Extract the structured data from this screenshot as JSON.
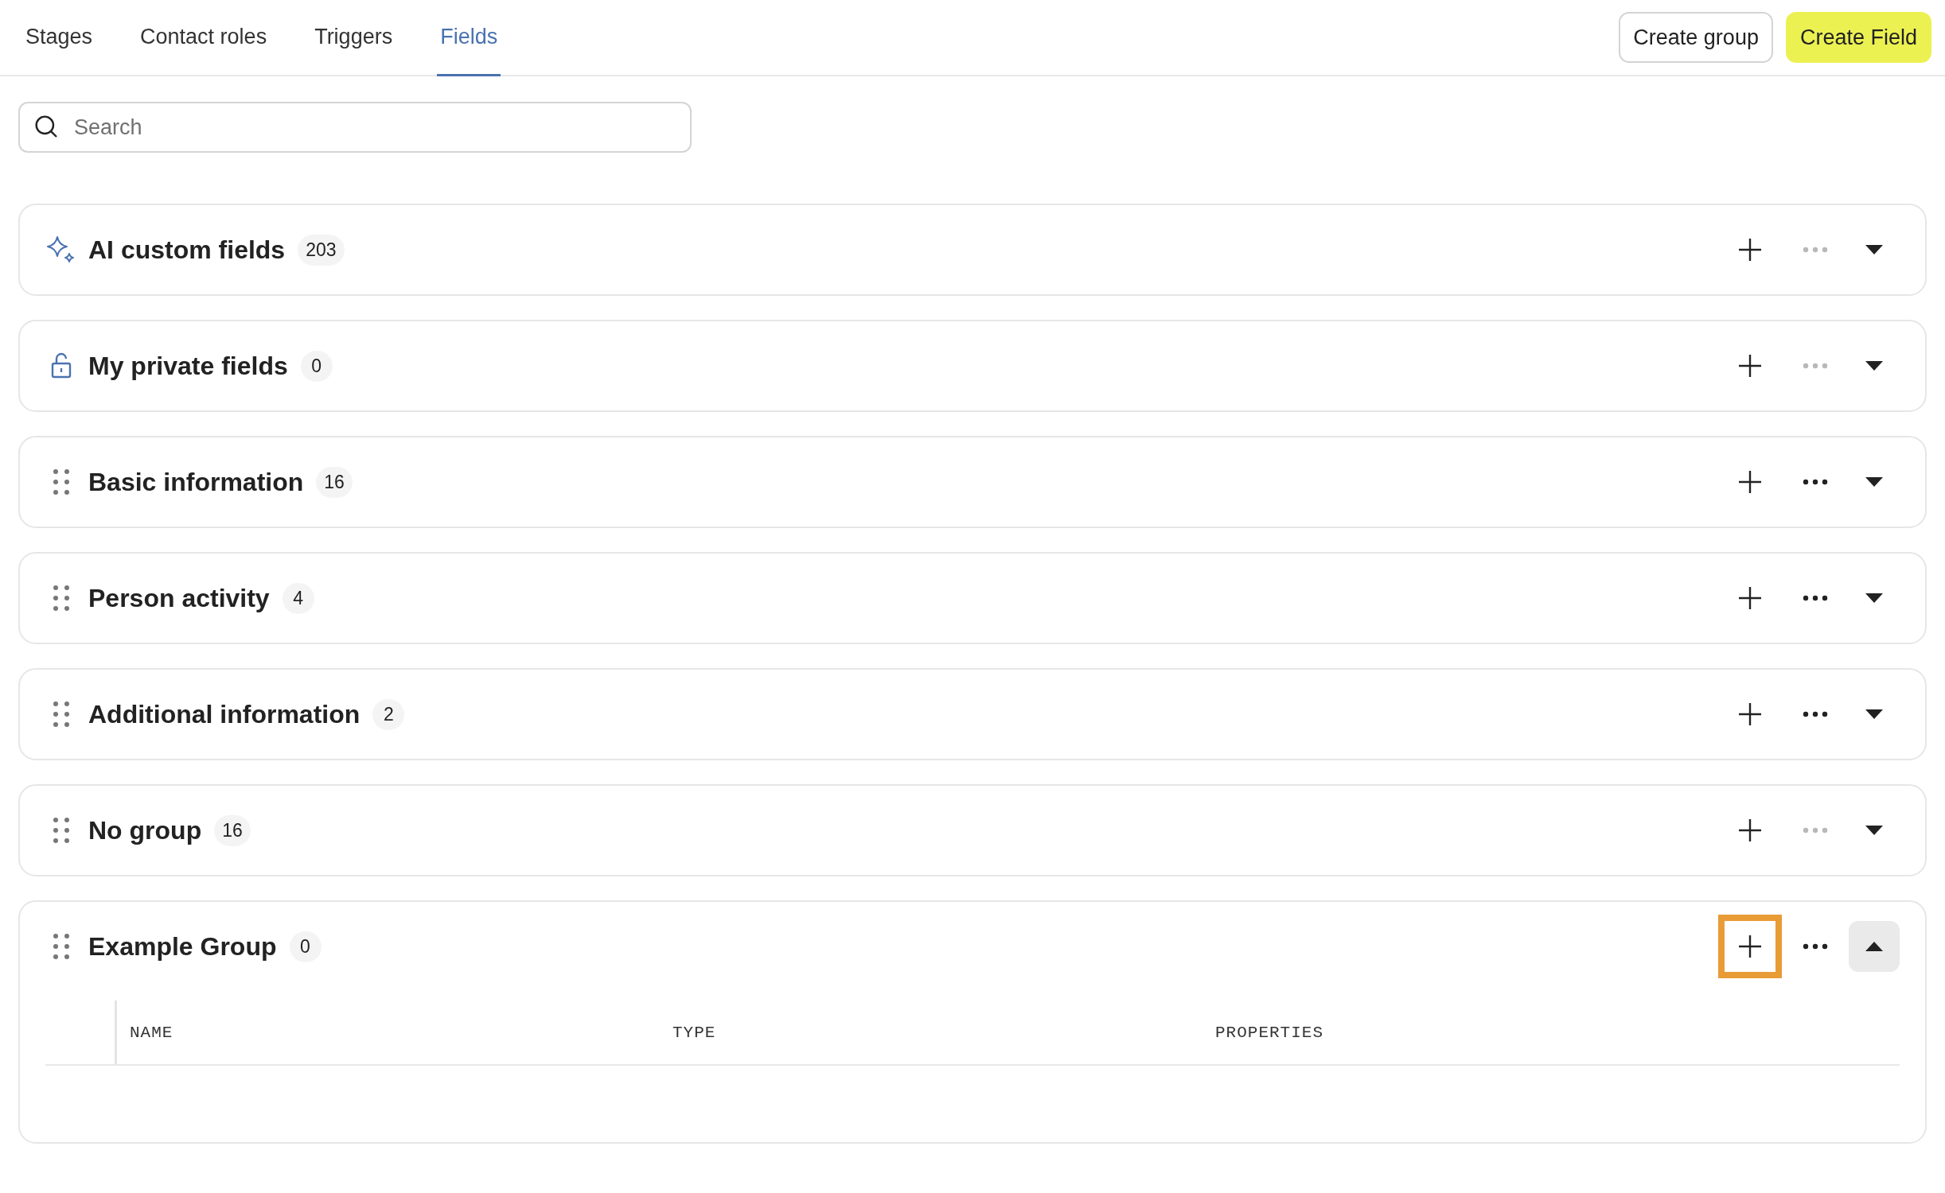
{
  "tabs": [
    {
      "label": "Stages",
      "selected": false
    },
    {
      "label": "Contact roles",
      "selected": false
    },
    {
      "label": "Triggers",
      "selected": false
    },
    {
      "label": "Fields",
      "selected": true
    }
  ],
  "actions": [
    {
      "label": "Create group",
      "kind": "secondary"
    },
    {
      "label": "Create Field",
      "kind": "primary"
    }
  ],
  "search": {
    "placeholder": "Search"
  },
  "groups": [
    {
      "kind": "ai",
      "title": "AI custom fields",
      "count": "203",
      "more_disabled": true,
      "expanded": false,
      "add_highlighted": false
    },
    {
      "kind": "private",
      "title": "My private fields",
      "count": "0",
      "more_disabled": true,
      "expanded": false,
      "add_highlighted": false
    },
    {
      "kind": "drag",
      "title": "Basic information",
      "count": "16",
      "more_disabled": false,
      "expanded": false,
      "add_highlighted": false
    },
    {
      "kind": "drag",
      "title": "Person activity",
      "count": "4",
      "more_disabled": false,
      "expanded": false,
      "add_highlighted": false
    },
    {
      "kind": "drag",
      "title": "Additional information",
      "count": "2",
      "more_disabled": false,
      "expanded": false,
      "add_highlighted": false
    },
    {
      "kind": "drag",
      "title": "No group",
      "count": "16",
      "more_disabled": true,
      "expanded": false,
      "add_highlighted": false
    },
    {
      "kind": "drag",
      "title": "Example Group",
      "count": "0",
      "more_disabled": false,
      "expanded": true,
      "add_highlighted": true,
      "columns": [
        "NAME",
        "TYPE",
        "PROPERTIES"
      ]
    }
  ]
}
